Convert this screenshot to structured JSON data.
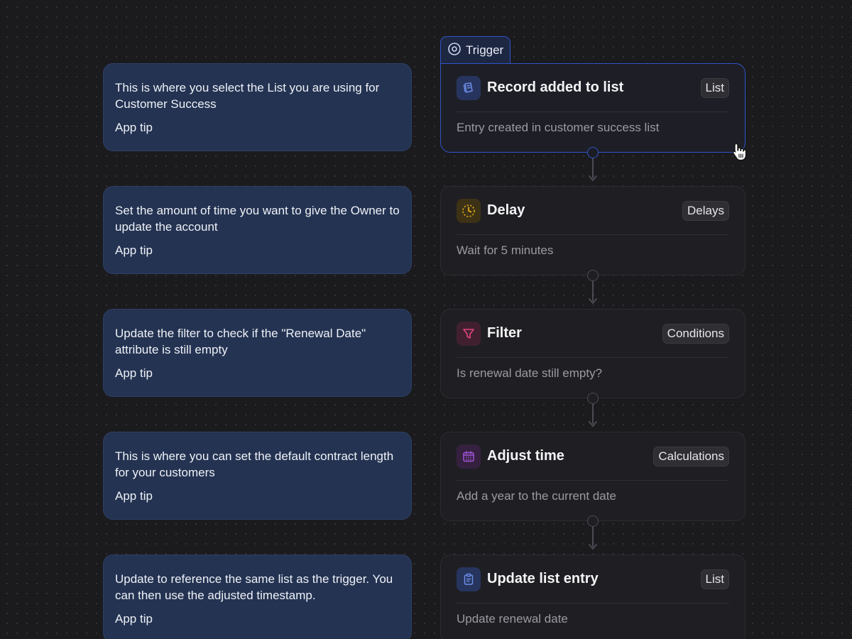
{
  "trigger_tab": {
    "label": "Trigger",
    "icon": "target-circle-icon"
  },
  "steps": [
    {
      "tip": {
        "text": "This is where you select the List you are using for Customer Success",
        "label": "App tip"
      },
      "node": {
        "title": "Record added to list",
        "badge": "List",
        "description": "Entry created in customer success list",
        "icon": "list-record-icon",
        "icon_color": "#5b7cdb"
      }
    },
    {
      "tip": {
        "text": "Set the amount of time you want to give the Owner to update the account",
        "label": "App tip"
      },
      "node": {
        "title": "Delay",
        "badge": "Delays",
        "description": "Wait for 5 minutes",
        "icon": "timer-icon",
        "icon_color": "#e0a915"
      }
    },
    {
      "tip": {
        "text": "Update the filter to check if the \"Renewal Date\" attribute is still empty",
        "label": "App tip"
      },
      "node": {
        "title": "Filter",
        "badge": "Conditions",
        "description": "Is renewal date still empty?",
        "icon": "filter-funnel-icon",
        "icon_color": "#e0457b"
      }
    },
    {
      "tip": {
        "text": "This is where you can set the default contract length for your customers",
        "label": "App tip"
      },
      "node": {
        "title": "Adjust time",
        "badge": "Calculations",
        "description": "Add a year to the current date",
        "icon": "calendar-icon",
        "icon_color": "#a055d8"
      }
    },
    {
      "tip": {
        "text": "Update to reference the same list as the trigger. You can then use the adjusted timestamp.",
        "label": "App tip"
      },
      "node": {
        "title": "Update list entry",
        "badge": "List",
        "description": "Update renewal date",
        "icon": "clipboard-icon",
        "icon_color": "#5b7cdb"
      }
    }
  ],
  "colors": {
    "background": "#1b1b1e",
    "tip_background": "#243352",
    "node_background": "#1f1f23",
    "accent": "#2f54c7"
  }
}
